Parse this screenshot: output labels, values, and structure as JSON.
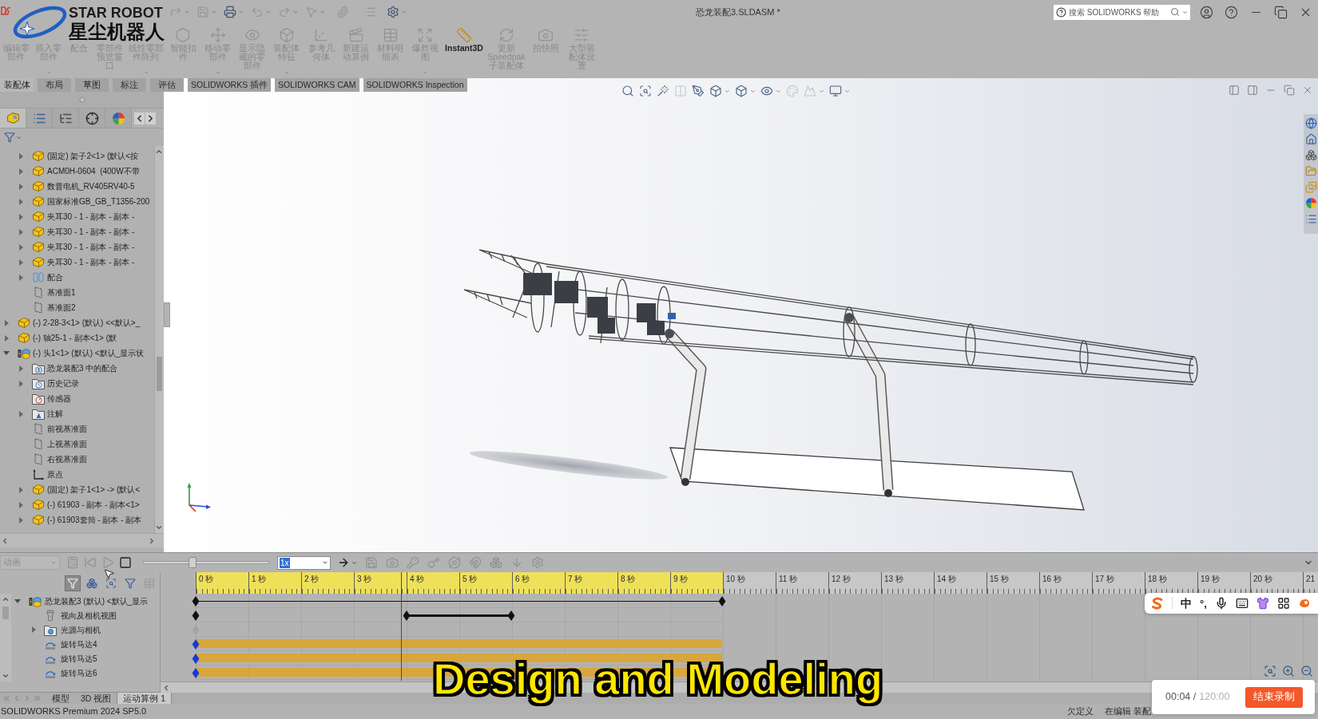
{
  "title_bar": {
    "title": "恐龙装配3.SLDASM *",
    "search": {
      "placeholder": "搜索 SOLIDWORKS 帮助"
    }
  },
  "channel_logo": {
    "name": "STAR ROBOT",
    "name_cn": "星尘机器人"
  },
  "quick_access": [
    {
      "disabled": true,
      "dropdown": true
    },
    {
      "disabled": true,
      "dropdown": true
    },
    {
      "disabled": false,
      "dropdown": true
    },
    {
      "disabled": true,
      "dropdown": true
    },
    {
      "disabled": true,
      "dropdown": true
    },
    {
      "disabled": true,
      "dropdown": true
    },
    {
      "disabled": true,
      "dropdown": false
    },
    {
      "disabled": true,
      "dropdown": false
    },
    {
      "disabled": false,
      "dropdown": true
    }
  ],
  "command_manager": {
    "buttons": [
      {
        "label": "编辑零部件",
        "disabled": true,
        "covered": true,
        "dropdown": false
      },
      {
        "label": "插入零部件",
        "disabled": true,
        "covered": true,
        "dropdown": true
      },
      {
        "label": "配合",
        "disabled": true,
        "covered": true,
        "dropdown": false
      },
      {
        "label": "零部件预览窗口",
        "disabled": true,
        "covered": true,
        "dropdown": false
      },
      {
        "label": "线性零部件阵列",
        "disabled": true,
        "covered": true,
        "dropdown": true
      },
      {
        "label": "智能扣件",
        "disabled": true,
        "covered": false,
        "dropdown": false
      },
      {
        "label": "移动零部件",
        "disabled": true,
        "covered": false,
        "dropdown": true
      },
      {
        "label": "显示隐藏的零部件",
        "disabled": true,
        "covered": false,
        "dropdown": false
      },
      {
        "label": "装配体特征",
        "disabled": true,
        "covered": false,
        "dropdown": true
      },
      {
        "label": "参考几何体",
        "disabled": true,
        "covered": false,
        "dropdown": false
      },
      {
        "label": "新建运动算例",
        "disabled": true,
        "covered": false,
        "dropdown": false
      },
      {
        "label": "材料明细表",
        "disabled": true,
        "covered": false,
        "dropdown": false
      },
      {
        "label": "爆炸视图",
        "disabled": true,
        "covered": false,
        "dropdown": true
      },
      {
        "label": "Instant3D",
        "disabled": false,
        "covered": false,
        "dropdown": false
      },
      {
        "label": "更新Speedpak子装配体",
        "disabled": true,
        "covered": false,
        "dropdown": false
      },
      {
        "label": "拍快照",
        "disabled": true,
        "covered": false,
        "dropdown": false
      },
      {
        "label": "大型装配体设置",
        "disabled": true,
        "covered": false,
        "dropdown": false
      }
    ]
  },
  "ribbon_tabs": [
    {
      "label": "装配体",
      "selected": true
    },
    {
      "label": "布局",
      "selected": false
    },
    {
      "label": "草图",
      "selected": false
    },
    {
      "label": "标注",
      "selected": false
    },
    {
      "label": "评估",
      "selected": false
    },
    {
      "label": "SOLIDWORKS 插件",
      "selected": false
    },
    {
      "label": "SOLIDWORKS CAM",
      "selected": false
    },
    {
      "label": "SOLIDWORKS Inspection",
      "selected": false
    }
  ],
  "feature_tree": {
    "panel_tabs": [
      {
        "selected": true
      },
      {
        "selected": false
      },
      {
        "selected": false
      },
      {
        "selected": false
      },
      {
        "selected": false
      }
    ],
    "continued_children": [
      {
        "label": "(固定) 架子2<1> (默认<按",
        "kind": "part",
        "expanded": false
      },
      {
        "label": "ACM0H-0604  (400W不带",
        "kind": "part",
        "expanded": false
      },
      {
        "label": "数普电机_RV405RV40-5",
        "kind": "part",
        "expanded": false
      },
      {
        "label": "国家标准GB_GB_T1356-200",
        "kind": "part",
        "expanded": false
      },
      {
        "label": "夹耳30 - 1 - 副本 - 副本 -",
        "kind": "part",
        "expanded": false
      },
      {
        "label": "夹耳30 - 1 - 副本 - 副本 -",
        "kind": "part",
        "expanded": false
      },
      {
        "label": "夹耳30 - 1 - 副本 - 副本 -",
        "kind": "part",
        "expanded": false
      },
      {
        "label": "夹耳30 - 1 - 副本 - 副本 -",
        "kind": "part",
        "expanded": false
      },
      {
        "label": "配合",
        "kind": "mates",
        "expanded": false
      },
      {
        "label": "基准面1",
        "kind": "plane"
      },
      {
        "label": "基准面2",
        "kind": "plane"
      }
    ],
    "items": [
      {
        "label": "(-) 2-28-3<1> (默认) <<默认>_",
        "kind": "part",
        "expanded": false
      },
      {
        "label": "(-) 轴25-1 - 副本<1> (默",
        "kind": "part",
        "expanded": false
      },
      {
        "label": "(-) 头1<1> (默认) <默认_显示状",
        "kind": "assembly",
        "expanded": true,
        "children": [
          {
            "label": "恐龙装配3 中的配合",
            "kind": "mate_folder",
            "expanded": false
          },
          {
            "label": "历史记录",
            "kind": "history",
            "expanded": false
          },
          {
            "label": "传感器",
            "kind": "sensor"
          },
          {
            "label": "注解",
            "kind": "annotation",
            "expanded": false
          },
          {
            "label": "前视基准面",
            "kind": "plane"
          },
          {
            "label": "上视基准面",
            "kind": "plane"
          },
          {
            "label": "右视基准面",
            "kind": "plane"
          },
          {
            "label": "原点",
            "kind": "origin"
          },
          {
            "label": "(固定) 架子1<1> -> (默认<",
            "kind": "part",
            "expanded": false
          },
          {
            "label": "(-) 61903 - 副本 - 副本<1>",
            "kind": "part",
            "expanded": false
          },
          {
            "label": "(-) 61903套筒 - 副本 - 副本",
            "kind": "part",
            "expanded": false
          }
        ]
      }
    ]
  },
  "viewport": {
    "view_tools": [
      {
        "disabled": false,
        "dropdown": false
      },
      {
        "disabled": false,
        "dropdown": false
      },
      {
        "disabled": false,
        "dropdown": false
      },
      {
        "disabled": true,
        "dropdown": false
      },
      {
        "disabled": false,
        "dropdown": false
      },
      {
        "disabled": false,
        "dropdown": true
      },
      {
        "disabled": false,
        "dropdown": true
      },
      {
        "disabled": false,
        "dropdown": true
      },
      {
        "disabled": true,
        "dropdown": false
      },
      {
        "disabled": true,
        "dropdown": true
      },
      {
        "disabled": false,
        "dropdown": true
      }
    ]
  },
  "motion_study": {
    "toolbar": {
      "study_type": {
        "value": "动画",
        "disabled": true
      },
      "tools": [
        {
          "disabled": true,
          "dropdown": false
        },
        {
          "disabled": true,
          "dropdown": false
        },
        {
          "disabled": true,
          "dropdown": false
        },
        {
          "disabled": false,
          "dropdown": false
        },
        {
          "disabled": false,
          "dropdown": true
        },
        {
          "disabled": true,
          "dropdown": false
        },
        {
          "disabled": true,
          "dropdown": false
        },
        {
          "disabled": true,
          "dropdown": false
        },
        {
          "disabled": true,
          "dropdown": false
        },
        {
          "disabled": true,
          "dropdown": false
        },
        {
          "disabled": true,
          "dropdown": false
        },
        {
          "disabled": true,
          "dropdown": false
        },
        {
          "disabled": true,
          "dropdown": false
        },
        {
          "disabled": true,
          "dropdown": false
        }
      ],
      "slider": {
        "level": 0.39
      },
      "speed": {
        "value": "1x",
        "highlighted": true
      }
    },
    "filters": [
      {
        "selected": true,
        "disabled": false
      },
      {
        "selected": false,
        "disabled": false
      },
      {
        "selected": false,
        "disabled": false
      },
      {
        "selected": false,
        "disabled": false
      },
      {
        "selected": false,
        "disabled": true
      }
    ],
    "ruler": [
      {
        "label": "0 秒",
        "in_range": true
      },
      {
        "label": "1 秒",
        "in_range": true
      },
      {
        "label": "2 秒",
        "in_range": true
      },
      {
        "label": "3 秒",
        "in_range": true
      },
      {
        "label": "4 秒",
        "in_range": true
      },
      {
        "label": "5 秒",
        "in_range": true
      },
      {
        "label": "6 秒",
        "in_range": true
      },
      {
        "label": "7 秒",
        "in_range": true
      },
      {
        "label": "8 秒",
        "in_range": true
      },
      {
        "label": "9 秒",
        "in_range": true
      },
      {
        "label": "10 秒",
        "in_range": false
      },
      {
        "label": "11 秒",
        "in_range": false
      },
      {
        "label": "12 秒",
        "in_range": false
      },
      {
        "label": "13 秒",
        "in_range": false
      },
      {
        "label": "14 秒",
        "in_range": false
      },
      {
        "label": "15 秒",
        "in_range": false
      },
      {
        "label": "16 秒",
        "in_range": false
      },
      {
        "label": "17 秒",
        "in_range": false
      },
      {
        "label": "18 秒",
        "in_range": false
      },
      {
        "label": "19 秒",
        "in_range": false
      },
      {
        "label": "20 秒",
        "in_range": false
      },
      {
        "label": "21",
        "in_range": false
      }
    ],
    "cursor": {
      "level": 0.39
    },
    "rows": [
      {
        "label": "恐龙装配3 (默认) <默认_显示",
        "kind": "assembly",
        "expanded": true,
        "track": [
          {
            "kind": "key",
            "level": 0,
            "color": "#111111"
          },
          {
            "kind": "span",
            "level": 1,
            "color": "#111111"
          }
        ],
        "children": [
          {
            "label": "视向及相机视图",
            "kind": "camera_view",
            "track": [
              {
                "kind": "key",
                "level": 0,
                "color": "#111111"
              },
              {
                "kind": "key",
                "level": 0.4,
                "color": "#111111"
              },
              {
                "kind": "bar",
                "level": 0.6,
                "color": "#111111"
              }
            ]
          },
          {
            "label": "光源与相机",
            "kind": "lights_folder",
            "expanded": false,
            "track": [
              {
                "kind": "key",
                "level": 0,
                "color": "#a3a3a3"
              }
            ]
          },
          {
            "label": "旋转马达4",
            "kind": "motor",
            "track": [
              {
                "kind": "fill",
                "level": 1
              },
              {
                "kind": "key",
                "level": 0,
                "color": "#1739d6"
              }
            ]
          },
          {
            "label": "旋转马达5",
            "kind": "motor",
            "track": [
              {
                "kind": "fill",
                "level": 1
              },
              {
                "kind": "key",
                "level": 0,
                "color": "#1739d6"
              }
            ]
          },
          {
            "label": "旋转马达6",
            "kind": "motor",
            "track": [
              {
                "kind": "fill",
                "level": 1
              },
              {
                "kind": "key",
                "level": 0,
                "color": "#1739d6"
              }
            ]
          }
        ]
      }
    ]
  },
  "bottom_tabs": [
    {
      "label": "模型",
      "selected": false
    },
    {
      "label": "3D 视图",
      "selected": false
    },
    {
      "label": "运动算例 1",
      "selected": true
    }
  ],
  "status_bar": {
    "product": "SOLIDWORKS Premium 2024 SP5.0",
    "state": "欠定义",
    "mode": "在编辑 装配"
  },
  "ime_toolbar": {
    "mode": "中",
    "punctuation": "°,"
  },
  "recorder": {
    "elapsed": "00:04 /",
    "limit": "120:00",
    "stop_button": "结束录制"
  },
  "caption": "Design and Modeling"
}
